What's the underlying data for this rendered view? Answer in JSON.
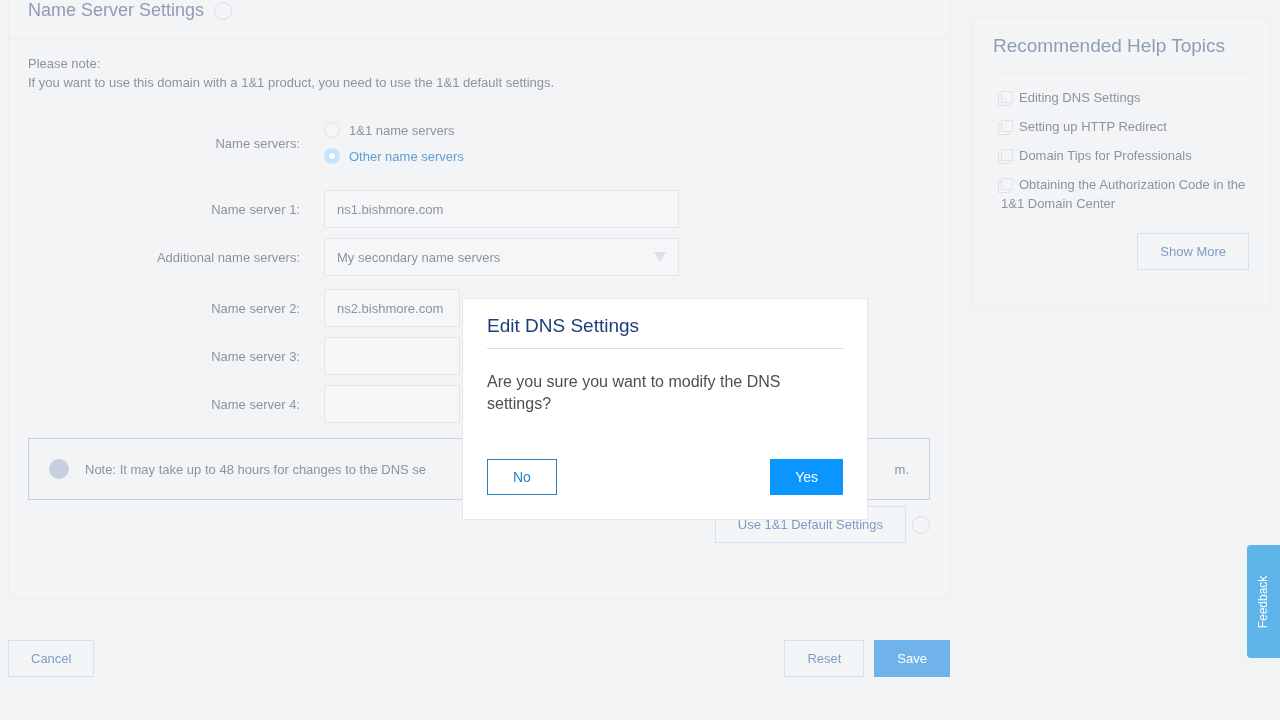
{
  "panel": {
    "title": "Name Server Settings",
    "note_heading": "Please note:",
    "note_text": "If you want to use this domain with a 1&1 product, you need to use the 1&1 default settings.",
    "name_servers": {
      "label": "Name servers:",
      "options": [
        {
          "label": "1&1 name servers",
          "selected": false
        },
        {
          "label": "Other name servers",
          "selected": true
        }
      ]
    },
    "fields": [
      {
        "kind": "input",
        "label": "Name server 1:",
        "value": "ns1.bishmore.com"
      },
      {
        "kind": "select",
        "label": "Additional name servers:",
        "value": "My secondary name servers"
      },
      {
        "kind": "input",
        "label": "Name server 2:",
        "value": "ns2.bishmore.com"
      },
      {
        "kind": "input",
        "label": "Name server 3:"
      },
      {
        "kind": "input",
        "label": "Name server 4:"
      }
    ],
    "info_note": {
      "text_start": "Note: It may take up to 48 hours for changes to the DNS se",
      "text_end": "m."
    },
    "default_button": "Use 1&1 Default Settings"
  },
  "footer": {
    "cancel": "Cancel",
    "reset": "Reset",
    "save": "Save"
  },
  "help": {
    "title": "Recommended Help Topics",
    "topics": [
      "Editing DNS Settings",
      "Setting up HTTP Redirect",
      "Domain Tips for Professionals",
      "Obtaining the Authorization Code in the 1&1 Domain Center"
    ],
    "show_more": "Show More"
  },
  "feedback_tab": "Feedback",
  "dialog": {
    "title": "Edit DNS Settings",
    "message": "Are you sure you want to modify the DNS settings?",
    "buttons": [
      {
        "kind": "secondary",
        "label": "No"
      },
      {
        "kind": "primary",
        "label": "Yes"
      }
    ]
  }
}
